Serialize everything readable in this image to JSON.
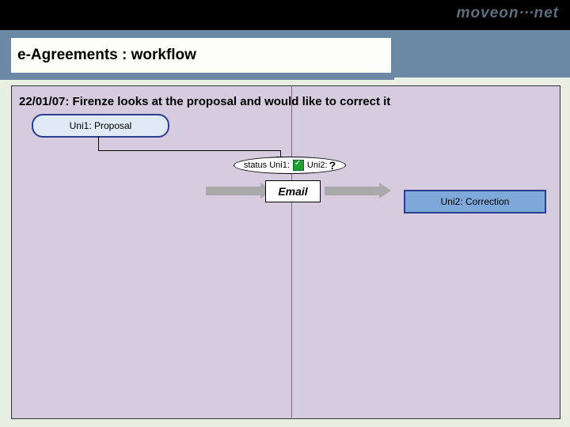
{
  "brand": {
    "name": "moveon",
    "dots": "···",
    "suffix": "net"
  },
  "title": "e-Agreements : workflow",
  "caption": "22/01/07: Firenze looks at the proposal and would like to correct it",
  "flow": {
    "proposal_label": "Uni1: Proposal",
    "status_prefix": "status Uni1:",
    "status_uni2_label": "Uni2:",
    "status_uni2_value": "?",
    "email_label": "Email",
    "correction_label": "Uni2: Correction"
  }
}
